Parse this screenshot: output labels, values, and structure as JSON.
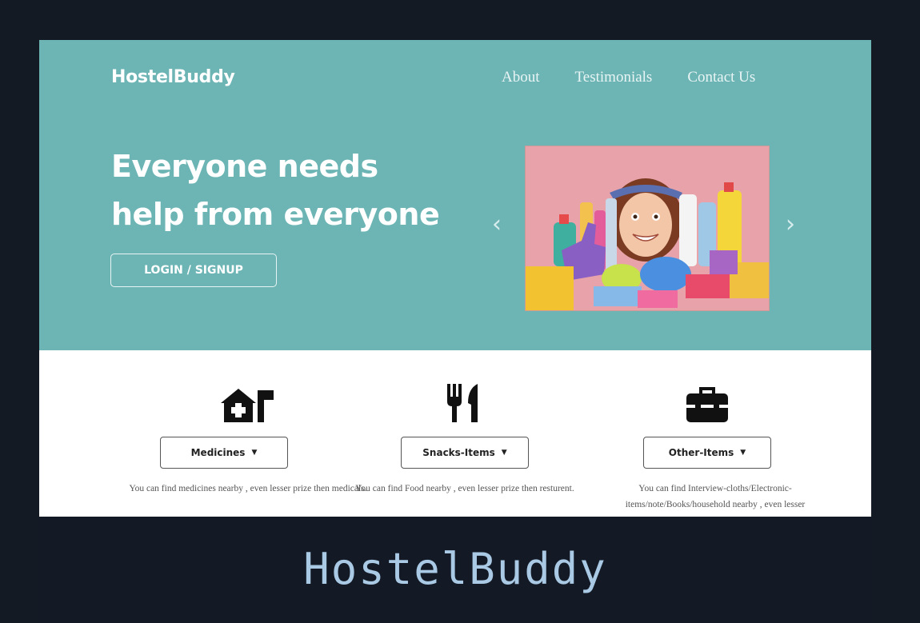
{
  "site": {
    "logo": "HostelBuddy",
    "nav": [
      {
        "label": "About"
      },
      {
        "label": "Testimonials"
      },
      {
        "label": "Contact Us"
      }
    ],
    "hero": {
      "headline_line1": "Everyone needs",
      "headline_line2": "help from everyone",
      "cta_label": "LOGIN / SIGNUP",
      "carousel_prev": "‹",
      "carousel_next": "›"
    },
    "features": [
      {
        "icon": "medical-house-icon",
        "label": "Medicines",
        "caret": "▼",
        "description": "You can find medicines nearby , even lesser prize then medicals."
      },
      {
        "icon": "fork-knife-icon",
        "label": "Snacks-Items",
        "caret": "▼",
        "description": "You can find Food nearby , even lesser prize then resturent."
      },
      {
        "icon": "toolbox-icon",
        "label": "Other-Items",
        "caret": "▼",
        "description": "You can find Interview-cloths/Electronic-items/note/Books/household nearby , even lesser"
      }
    ]
  },
  "caption": "HostelBuddy",
  "colors": {
    "hero_bg": "#6db5b5",
    "page_bg": "#141a24",
    "caption": "#a9c9e4"
  }
}
